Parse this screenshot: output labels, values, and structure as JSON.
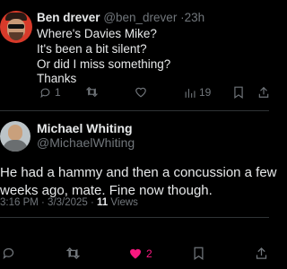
{
  "tweet1": {
    "author_name": "Ben drever",
    "author_handle": "@ben_drever",
    "time": "23h",
    "lines": [
      "Where's Davies Mike?",
      "It's been a bit silent?",
      "Or did I miss something?",
      "Thanks"
    ],
    "actions": {
      "replies": "1",
      "views": "19"
    }
  },
  "tweet2": {
    "author_name": "Michael Whiting",
    "author_handle": "@MichaelWhiting",
    "lines": [
      "He had a hammy and then a concussion a few",
      "weeks ago, mate. Fine now though."
    ],
    "timestamp": "3:16 PM · 3/3/2025 ·",
    "views_count": "11",
    "views_label": "Views",
    "actions": {
      "likes": "2"
    }
  },
  "colors": {
    "background": "#000000",
    "text": "#e7e9ea",
    "muted": "#71767b",
    "like": "#f91880"
  },
  "icons": [
    "reply-icon",
    "retweet-icon",
    "like-icon",
    "views-icon",
    "bookmark-icon",
    "share-icon"
  ]
}
